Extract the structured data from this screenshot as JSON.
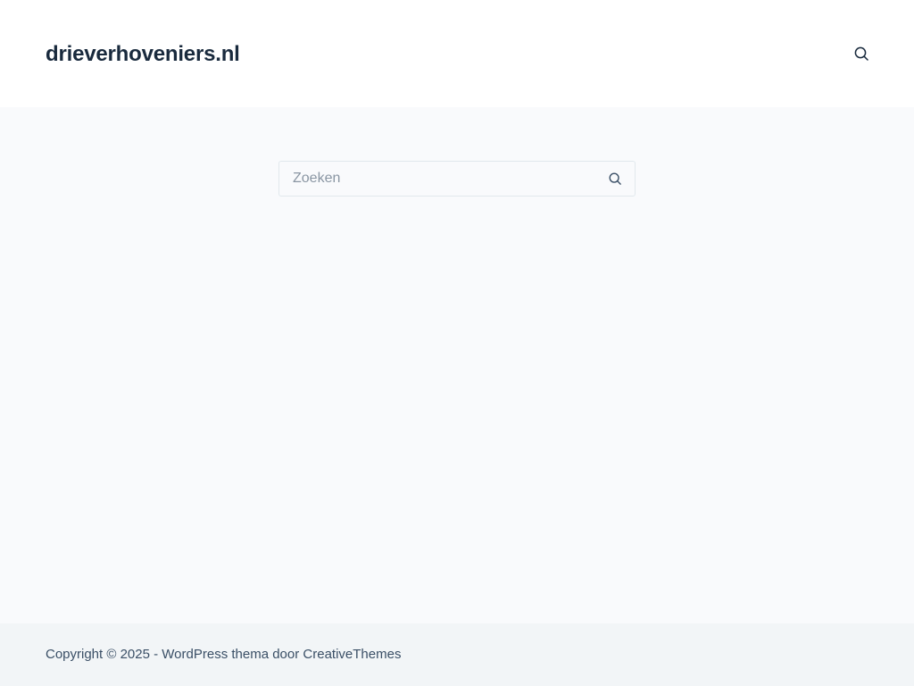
{
  "header": {
    "site_title": "drieverhoveniers.nl",
    "search_icon": "search-icon"
  },
  "main": {
    "search": {
      "placeholder": "Zoeken",
      "value": "",
      "submit_icon": "search-icon"
    }
  },
  "footer": {
    "copyright_prefix": "Copyright © 2025 - WordPress thema door ",
    "credit_link": "CreativeThemes"
  },
  "colors": {
    "header_bg": "#ffffff",
    "page_bg": "#f9fafc",
    "footer_bg": "#f2f5f7",
    "title_text": "#192a3d",
    "body_text": "#3a4f66",
    "border": "#e1e8ed"
  }
}
